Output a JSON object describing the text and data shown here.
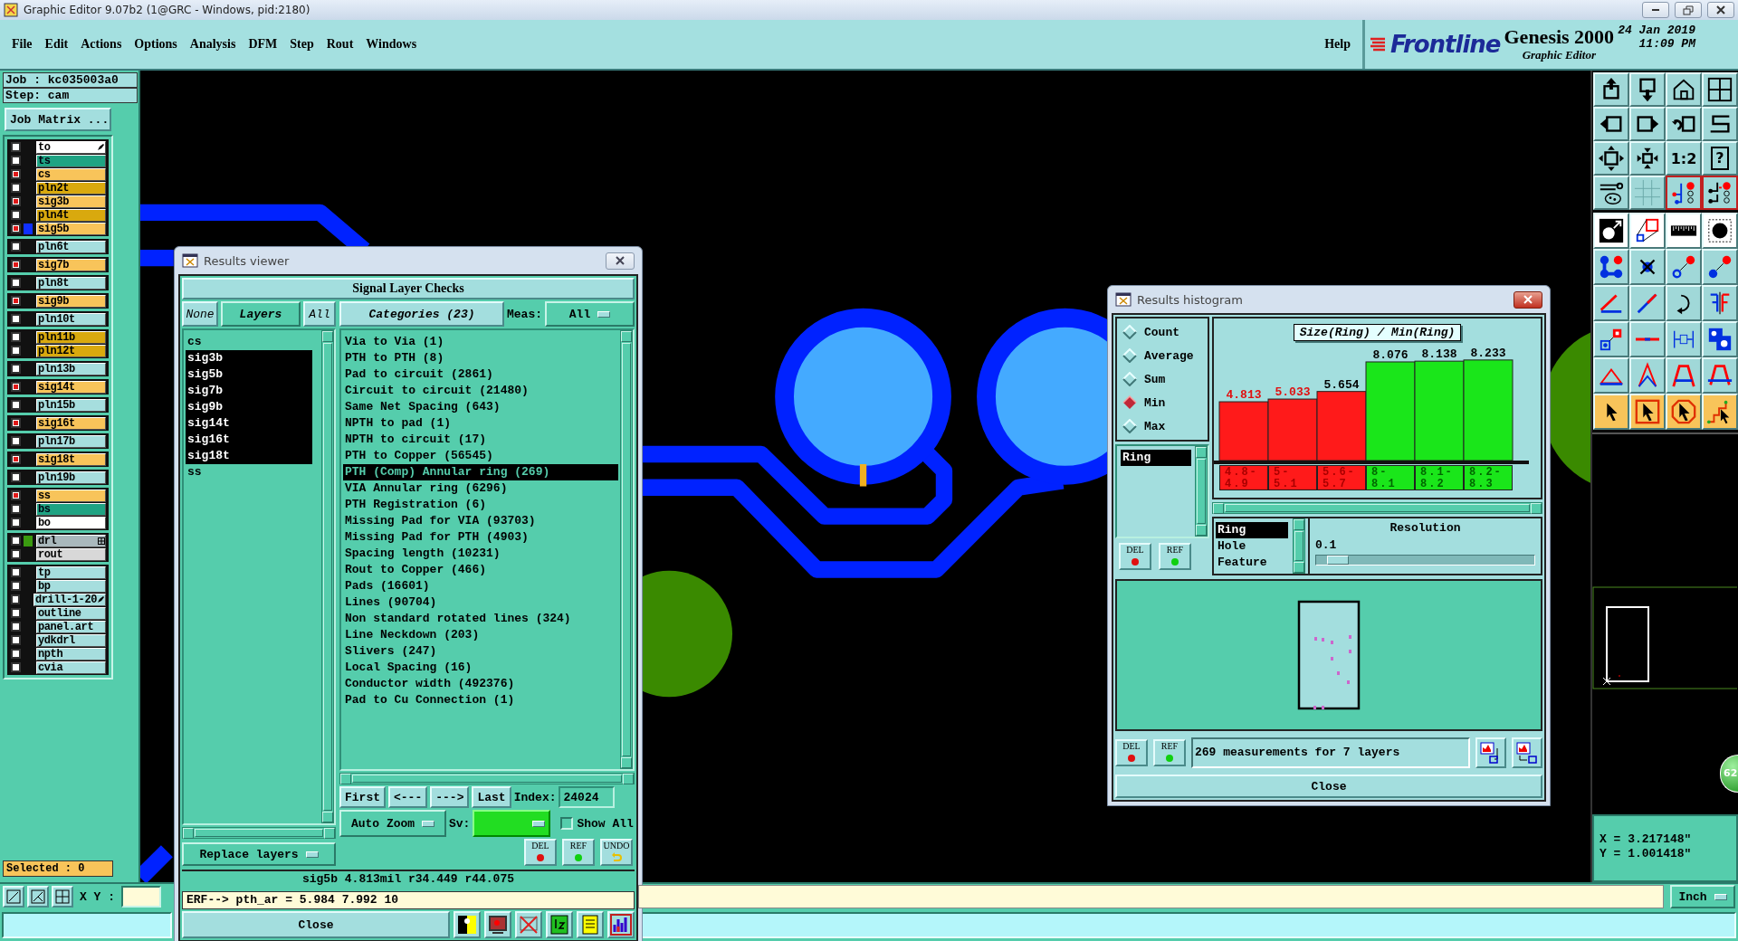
{
  "window": {
    "title": "Graphic Editor 9.07b2 (1@GRC - Windows, pid:2180)"
  },
  "menu": {
    "items": [
      "File",
      "Edit",
      "Actions",
      "Options",
      "Analysis",
      "DFM",
      "Step",
      "Rout",
      "Windows"
    ],
    "help": "Help"
  },
  "branding": {
    "product": "Frontline",
    "title": "Genesis 2000",
    "subtitle": "Graphic Editor",
    "date": "24 Jan 2019",
    "time": "11:09 PM"
  },
  "job_panel": {
    "job": "Job : kc035003a0",
    "step": "Step: cam",
    "matrix_button": "Job Matrix ...",
    "selected": "Selected : 0",
    "layer_groups": [
      [
        {
          "name": "to",
          "color": "#ffffff",
          "checked": false,
          "work_layer": true
        },
        {
          "name": "ts",
          "color": "#1fa383",
          "checked": false
        },
        {
          "name": "cs",
          "color": "#f8c45a",
          "checked": true
        },
        {
          "name": "pln2t",
          "color": "#d9a90e",
          "checked": false
        },
        {
          "name": "sig3b",
          "color": "#f8c45a",
          "checked": true
        },
        {
          "name": "pln4t",
          "color": "#d9a90e",
          "checked": false
        },
        {
          "name": "sig5b",
          "color": "#f8c45a",
          "checked": true,
          "swatch": {
            "color": "#1030ff"
          }
        }
      ],
      [
        {
          "name": "pln6t",
          "color": "#a6dede",
          "checked": false
        }
      ],
      [
        {
          "name": "sig7b",
          "color": "#f8c45a",
          "checked": true
        }
      ],
      [
        {
          "name": "pln8t",
          "color": "#a6dede",
          "checked": false
        }
      ],
      [
        {
          "name": "sig9b",
          "color": "#f8c45a",
          "checked": true
        }
      ],
      [
        {
          "name": "pln10t",
          "color": "#a6dede",
          "checked": false
        }
      ],
      [
        {
          "name": "pln11b",
          "color": "#d9a90e",
          "checked": false
        },
        {
          "name": "pln12t",
          "color": "#d9a90e",
          "checked": false
        }
      ],
      [
        {
          "name": "pln13b",
          "color": "#a6dede",
          "checked": false
        }
      ],
      [
        {
          "name": "sig14t",
          "color": "#f8c45a",
          "checked": true
        }
      ],
      [
        {
          "name": "pln15b",
          "color": "#a6dede",
          "checked": false
        }
      ],
      [
        {
          "name": "sig16t",
          "color": "#f8c45a",
          "checked": true
        }
      ],
      [
        {
          "name": "pln17b",
          "color": "#a6dede",
          "checked": false
        }
      ],
      [
        {
          "name": "sig18t",
          "color": "#f8c45a",
          "checked": true
        }
      ],
      [
        {
          "name": "pln19b",
          "color": "#a6dede",
          "checked": false
        }
      ],
      [
        {
          "name": "ss",
          "color": "#f8c45a",
          "checked": true
        },
        {
          "name": "bs",
          "color": "#1fa383",
          "checked": false
        },
        {
          "name": "bo",
          "color": "#ffffff",
          "checked": false
        }
      ],
      [
        {
          "name": "drl",
          "color": "#a9b8bc",
          "checked": false,
          "swatch": {
            "color": "#3a9a10"
          },
          "has_attributes": true
        },
        {
          "name": "rout",
          "color": "#d8d8d8",
          "checked": false
        }
      ],
      [
        {
          "name": "tp",
          "color": "#a6dede",
          "checked": false
        },
        {
          "name": "bp",
          "color": "#a6dede",
          "checked": false
        },
        {
          "name": "drill-1-20",
          "color": "#a6dede",
          "checked": false,
          "work_layer": true
        },
        {
          "name": "outline",
          "color": "#a6dede",
          "checked": false
        },
        {
          "name": "panel.art",
          "color": "#a6dede",
          "checked": false
        },
        {
          "name": "ydkdrl",
          "color": "#a6dede",
          "checked": false
        },
        {
          "name": "npth",
          "color": "#a6dede",
          "checked": false
        },
        {
          "name": "cvia",
          "color": "#a6dede",
          "checked": false
        }
      ]
    ]
  },
  "toolbar": {
    "scale_label": "1:2",
    "help_label": "?"
  },
  "coordinates": {
    "x": "X = 3.217148\"",
    "y": "Y = 1.001418\""
  },
  "bottom_bar": {
    "xy_label": "X Y :",
    "units": "Inch"
  },
  "badge": "62",
  "results_viewer": {
    "title": "Results viewer",
    "heading": "Signal Layer Checks",
    "none_button": "None",
    "layers_button": "Layers",
    "all_button": "All",
    "categories_button": "Categories (23)",
    "meas_label": "Meas:",
    "meas_value": "All",
    "layers": [
      {
        "name": "cs",
        "selected": false
      },
      {
        "name": "sig3b",
        "selected": true
      },
      {
        "name": "sig5b",
        "selected": true
      },
      {
        "name": "sig7b",
        "selected": true
      },
      {
        "name": "sig9b",
        "selected": true
      },
      {
        "name": "sig14t",
        "selected": true
      },
      {
        "name": "sig16t",
        "selected": true
      },
      {
        "name": "sig18t",
        "selected": true
      },
      {
        "name": "ss",
        "selected": false
      }
    ],
    "categories": [
      {
        "label": "Via to Via (1)",
        "selected": false
      },
      {
        "label": "PTH to PTH (8)",
        "selected": false
      },
      {
        "label": "Pad to circuit (2861)",
        "selected": false
      },
      {
        "label": "Circuit to circuit (21480)",
        "selected": false
      },
      {
        "label": "Same Net Spacing (643)",
        "selected": false
      },
      {
        "label": "NPTH to pad (1)",
        "selected": false
      },
      {
        "label": "NPTH to circuit (17)",
        "selected": false
      },
      {
        "label": "PTH to Copper (56545)",
        "selected": false
      },
      {
        "label": "PTH (Comp) Annular ring (269)",
        "selected": true
      },
      {
        "label": "VIA Annular ring (6296)",
        "selected": false
      },
      {
        "label": "PTH Registration (6)",
        "selected": false
      },
      {
        "label": "Missing Pad for VIA (93703)",
        "selected": false
      },
      {
        "label": "Missing Pad for PTH (4903)",
        "selected": false
      },
      {
        "label": "Spacing length (10231)",
        "selected": false
      },
      {
        "label": "Rout to Copper (466)",
        "selected": false
      },
      {
        "label": "Pads (16601)",
        "selected": false
      },
      {
        "label": "Lines (90704)",
        "selected": false
      },
      {
        "label": "Non standard rotated lines (324)",
        "selected": false
      },
      {
        "label": "Line Neckdown (203)",
        "selected": false
      },
      {
        "label": "Slivers (247)",
        "selected": false
      },
      {
        "label": "Local Spacing (16)",
        "selected": false
      },
      {
        "label": "Conductor width (492376)",
        "selected": false
      },
      {
        "label": "Pad to Cu Connection (1)",
        "selected": false
      }
    ],
    "nav": [
      "First",
      "<---",
      "--->",
      "Last"
    ],
    "index_label": "Index:",
    "index_value": "24024",
    "zoom_mode": "Auto Zoom",
    "severity": {
      "label": "Sv:",
      "color": "#22dd22"
    },
    "show_all": {
      "label": "Show All",
      "checked": false
    },
    "layers_mode": "Replace layers",
    "actions": [
      {
        "label": "DEL",
        "kind": "delete"
      },
      {
        "label": "REF",
        "kind": "reference"
      },
      {
        "label": "UNDO",
        "kind": "undo"
      }
    ],
    "info": "sig5b 4.813mil r34.449 r44.075",
    "erf": "ERF--> pth_ar = 5.984 7.992 10",
    "close": "Close"
  },
  "histogram": {
    "title": "Results histogram",
    "modes": [
      {
        "label": "Count",
        "selected": false
      },
      {
        "label": "Average",
        "selected": false
      },
      {
        "label": "Sum",
        "selected": false
      },
      {
        "label": "Min",
        "selected": true
      },
      {
        "label": "Max",
        "selected": false
      }
    ],
    "fields": [
      {
        "label": "Ring",
        "selected": true
      }
    ],
    "field_actions": [
      {
        "label": "DEL",
        "kind": "delete"
      },
      {
        "label": "REF",
        "kind": "reference"
      }
    ],
    "chart_data": {
      "type": "bar",
      "title": "Size(Ring) / Min(Ring)",
      "categories": [
        "4.8-4.9",
        "5-5.1",
        "5.6-5.7",
        "8-8.1",
        "8.1-8.2",
        "8.2-8.3"
      ],
      "stacked": true,
      "data_labels": true,
      "series": [
        {
          "color": "#ff1a1a",
          "values": [
            4.813,
            5.033,
            5.654,
            null,
            null,
            null
          ]
        },
        {
          "color": "#1ae61a",
          "values": [
            null,
            null,
            null,
            8.076,
            8.138,
            8.233
          ]
        }
      ]
    },
    "attributes": [
      {
        "label": "Ring",
        "selected": true
      },
      {
        "label": "Hole",
        "selected": false
      },
      {
        "label": "Feature",
        "selected": false
      }
    ],
    "resolution": {
      "label": "Resolution",
      "value": "0.1",
      "level": 0.05
    },
    "actions": [
      {
        "label": "DEL",
        "kind": "delete"
      },
      {
        "label": "REF",
        "kind": "reference"
      }
    ],
    "summary": "269 measurements for 7 layers",
    "close": "Close"
  }
}
